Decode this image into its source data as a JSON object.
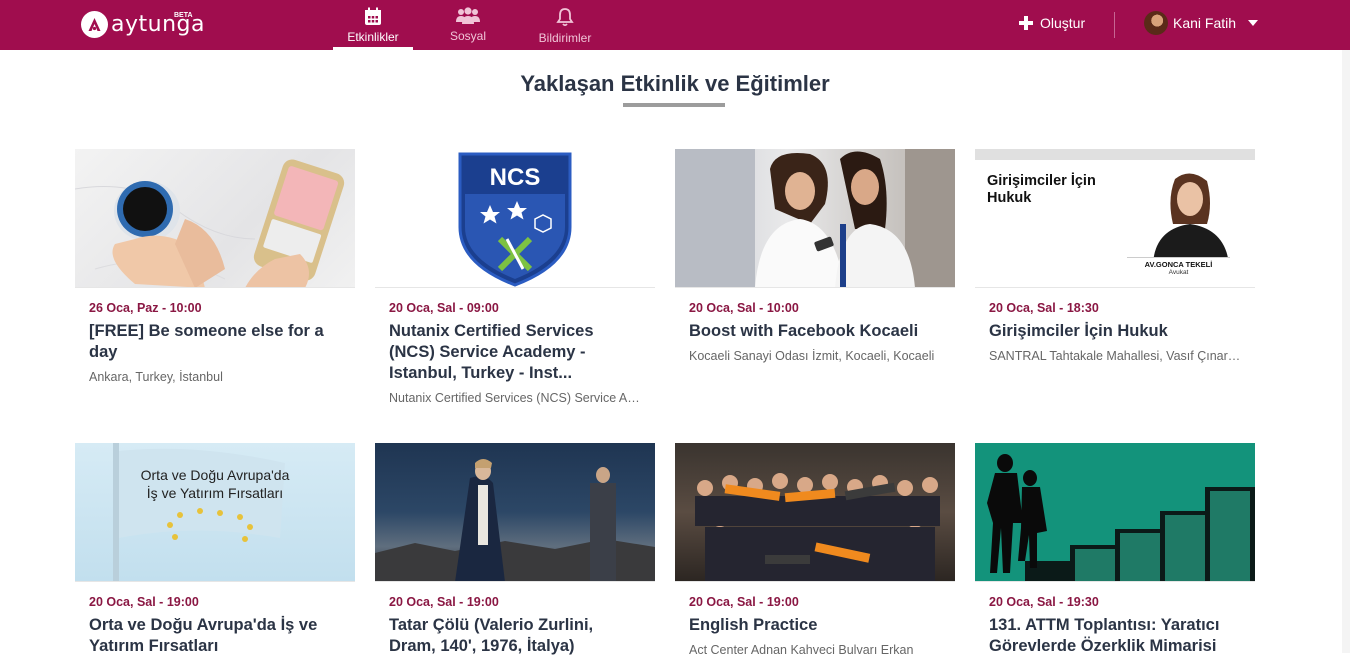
{
  "app": {
    "logo_text": "aytunga",
    "beta": "BETA"
  },
  "nav": [
    {
      "label": "Etkinlikler",
      "active": true
    },
    {
      "label": "Sosyal",
      "active": false
    },
    {
      "label": "Bildirimler",
      "active": false
    }
  ],
  "header": {
    "create_label": "Oluştur",
    "user_name": "Kani Fatih"
  },
  "page": {
    "title": "Yaklaşan Etkinlik ve Eğitimler"
  },
  "cards": [
    {
      "date": "26 Oca, Paz - 10:00",
      "title": "[FREE] Be someone else for a day",
      "location": "Ankara, Turkey, İstanbul"
    },
    {
      "date": "20 Oca, Sal - 09:00",
      "title": "Nutanix Certified Services (NCS) Service Academy - Istanbul, Turkey - Inst...",
      "location": "Nutanix Certified Services (NCS) Service Academy - Istanbul",
      "thumb_text": "NCS"
    },
    {
      "date": "20 Oca, Sal - 10:00",
      "title": "Boost with Facebook Kocaeli",
      "location": "Kocaeli Sanayi Odası İzmit, Kocaeli, Kocaeli"
    },
    {
      "date": "20 Oca, Sal - 18:30",
      "title": "Girişimciler İçin Hukuk",
      "location": "SANTRAL Tahtakale Mahallesi, Vasıf Çınar Caddesi",
      "thumb_title": "Girişimciler İçin Hukuk",
      "thumb_name": "AV.GONCA TEKELİ",
      "thumb_role": "Avukat"
    },
    {
      "date": "20 Oca, Sal - 19:00",
      "title": "Orta ve Doğu Avrupa'da İş ve Yatırım Fırsatları",
      "location": "",
      "thumb_line1": "Orta ve Doğu Avrupa'da",
      "thumb_line2": "İş ve Yatırım Fırsatları"
    },
    {
      "date": "20 Oca, Sal - 19:00",
      "title": "Tatar Çölü (Valerio Zurlini, Dram, 140', 1976, İtalya)",
      "location": ""
    },
    {
      "date": "20 Oca, Sal - 19:00",
      "title": "English Practice",
      "location": "Act Center Adnan Kahveci Bulvarı Erkan"
    },
    {
      "date": "20 Oca, Sal - 19:30",
      "title": "131. ATTM Toplantısı: Yaratıcı Görevlerde Özerklik Mimarisi",
      "location": ""
    }
  ],
  "colors": {
    "brand": "#a00d4e",
    "date": "#8a1743",
    "title": "#2b3445"
  }
}
